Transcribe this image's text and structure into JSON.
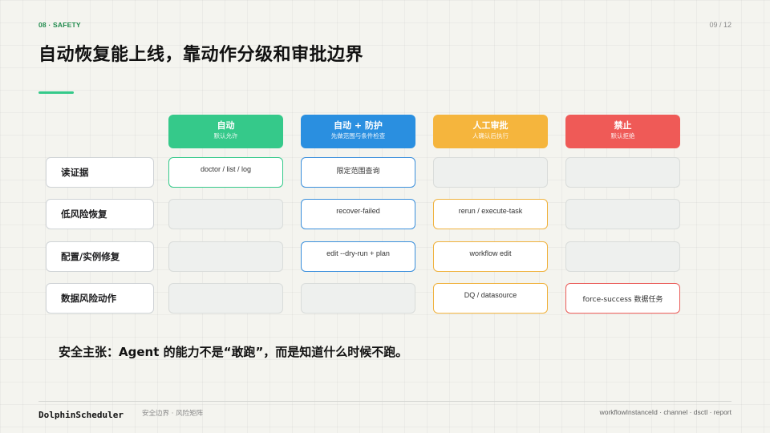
{
  "header": {
    "section_label": "08 · SAFETY",
    "page_number": "09 / 12",
    "title": "自动恢复能上线，靠动作分级和审批边界"
  },
  "colors": {
    "auto": "#35c98a",
    "auto_guarded": "#2a8fe0",
    "manual_approval": "#f5b53d",
    "forbidden": "#ef5a57",
    "accent": "#35c98a"
  },
  "columns": [
    {
      "title": "自动",
      "subtitle": "默认允许"
    },
    {
      "title": "自动 + 防护",
      "subtitle": "先做范围与条件检查"
    },
    {
      "title": "人工审批",
      "subtitle": "人确认后执行"
    },
    {
      "title": "禁止",
      "subtitle": "默认拒绝"
    }
  ],
  "rows": [
    {
      "label": "读证据",
      "cells": [
        "doctor / list / log",
        "限定范围查询",
        "",
        ""
      ]
    },
    {
      "label": "低风险恢复",
      "cells": [
        "",
        "recover-failed",
        "rerun / execute-task",
        ""
      ]
    },
    {
      "label": "配置/实例修复",
      "cells": [
        "",
        "edit --dry-run + plan",
        "workflow edit",
        ""
      ]
    },
    {
      "label": "数据风险动作",
      "cells": [
        "",
        "",
        "DQ / datasource",
        "force-success 数据任务"
      ]
    }
  ],
  "statement": "安全主张：Agent 的能力不是“敢跑”，而是知道什么时候不跑。",
  "footer": {
    "brand": "DolphinScheduler",
    "caption": "安全边界 · 风险矩阵",
    "keywords": "workflowInstanceId · channel · dsctl · report"
  }
}
